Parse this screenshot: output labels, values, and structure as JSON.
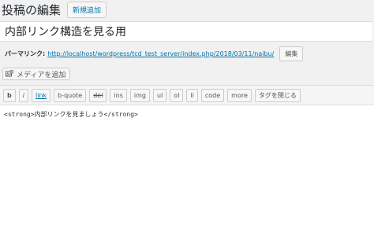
{
  "header": {
    "title": "投稿の編集",
    "add_new": "新規追加"
  },
  "post_title": "内部リンク構造を見る用",
  "permalink": {
    "label": "パーマリンク:",
    "url": "http://localhost/wordpress/tcd_test_server/index.php/2018/03/11/naibu/",
    "edit_label": "編集"
  },
  "media_button": {
    "label": "メディアを追加",
    "icon": "media-add-icon"
  },
  "quicktags": [
    "b",
    "i",
    "link",
    "b-quote",
    "del",
    "ins",
    "img",
    "ul",
    "ol",
    "li",
    "code",
    "more",
    "タグを閉じる"
  ],
  "editor_content": "<strong>内部リンクを見ましょう</strong>",
  "colors": {
    "link": "#0073aa",
    "background": "#f1f1f1",
    "toolbar": "#f5f5f5"
  }
}
